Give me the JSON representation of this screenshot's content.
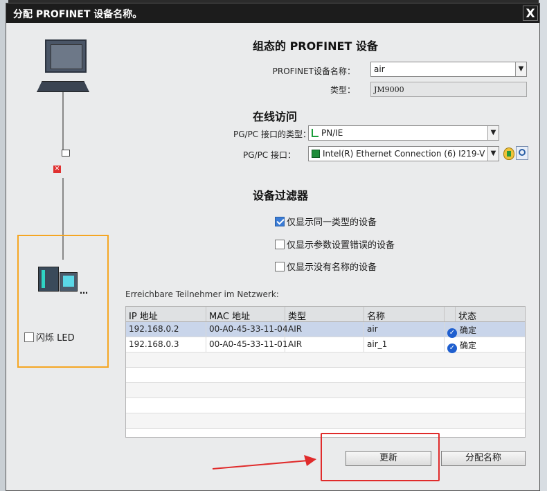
{
  "dialog": {
    "title": "分配 PROFINET 设备名称。",
    "close_label": "X"
  },
  "configured": {
    "heading": "组态的 PROFINET 设备",
    "name_label": "PROFINET设备名称：",
    "name_value": "air",
    "type_label": "类型：",
    "type_value": "JM9000"
  },
  "online": {
    "heading": "在线访问",
    "iftype_label": "PG/PC 接口的类型：",
    "iftype_value": "PN/IE",
    "iface_label": "PG/PC 接口：",
    "iface_value": "Intel(R) Ethernet Connection (6) I219-V"
  },
  "filter": {
    "heading": "设备过滤器",
    "options": [
      {
        "label": "仅显示同一类型的设备",
        "checked": true
      },
      {
        "label": "仅显示参数设置错误的设备",
        "checked": false
      },
      {
        "label": "仅显示没有名称的设备",
        "checked": false
      }
    ]
  },
  "left": {
    "flash_led_label": "闪烁 LED"
  },
  "network": {
    "caption": "Erreichbare Teilnehmer im Netzwerk:",
    "columns": [
      "IP 地址",
      "MAC 地址",
      "类型",
      "名称",
      "状态"
    ],
    "rows": [
      {
        "ip": "192.168.0.2",
        "mac": "00-A0-45-33-11-04",
        "type": "AIR",
        "name": "air",
        "status": "确定"
      },
      {
        "ip": "192.168.0.3",
        "mac": "00-A0-45-33-11-01",
        "type": "AIR",
        "name": "air_1",
        "status": "确定"
      }
    ]
  },
  "buttons": {
    "refresh": "更新",
    "assign": "分配名称"
  }
}
